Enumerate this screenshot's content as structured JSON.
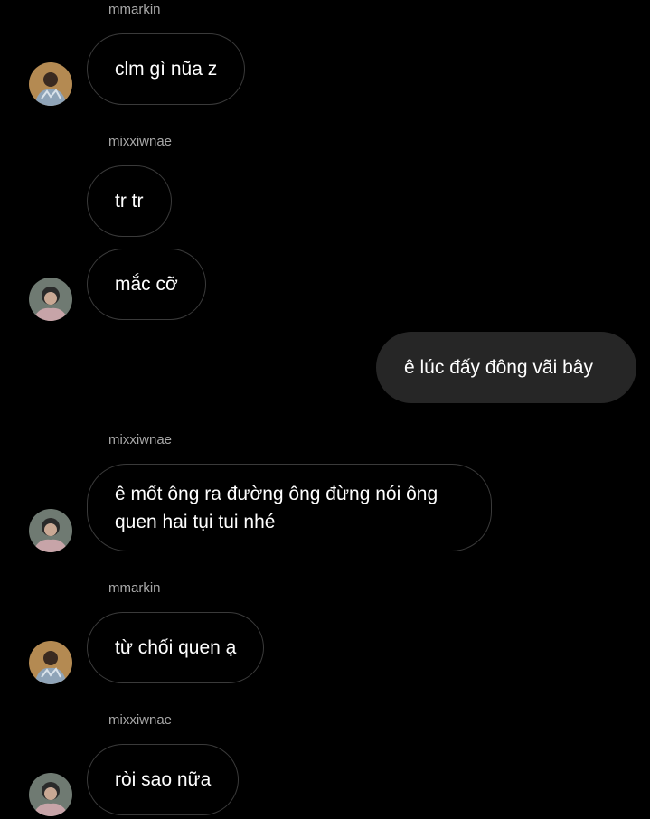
{
  "messages": [
    {
      "sender": "mmarkin",
      "text": "clm gì nũa z",
      "avatar": "mmarkin-avatar"
    },
    {
      "sender": "mixxiwnae",
      "text": "tr tr"
    },
    {
      "text": "mắc cỡ",
      "avatar": "mixxiwnae-avatar"
    },
    {
      "outgoing": true,
      "text": "ê lúc đấy đông vãi bây"
    },
    {
      "sender": "mixxiwnae",
      "text": "ê mốt ông ra đường ông đừng nói ông quen hai tụi tui nhé",
      "avatar": "mixxiwnae-avatar"
    },
    {
      "sender": "mmarkin",
      "text": "từ chối quen ạ",
      "avatar": "mmarkin-avatar"
    },
    {
      "sender": "mixxiwnae",
      "text": "ròi sao nữa",
      "avatar": "mixxiwnae-avatar"
    }
  ],
  "colors": {
    "background": "#000000",
    "incoming_border": "#3a3a3a",
    "outgoing_bubble": "#262626",
    "sender_text": "#a8a8a8",
    "message_text": "#ffffff"
  }
}
